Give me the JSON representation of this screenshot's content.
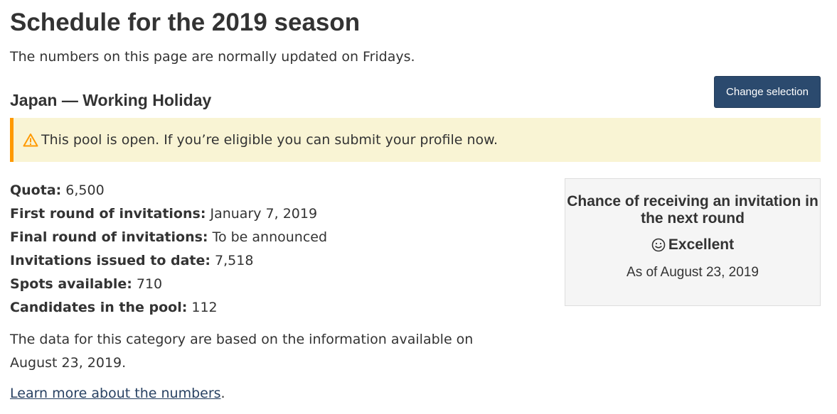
{
  "page": {
    "title": "Schedule for the 2019 season",
    "subtitle": "The numbers on this page are normally updated on Fridays."
  },
  "selection": {
    "heading": "Japan — Working Holiday",
    "change_button_label": "Change selection"
  },
  "alert": {
    "icon": "warning-triangle-icon",
    "message": "This pool is open. If you’re eligible you can submit your profile now.",
    "accent_color": "#ff9900",
    "background_color": "#f9f4d4"
  },
  "details": [
    {
      "label": "Quota:",
      "value": "6,500"
    },
    {
      "label": "First round of invitations:",
      "value": "January 7, 2019"
    },
    {
      "label": "Final round of invitations:",
      "value": "To be announced"
    },
    {
      "label": "Invitations issued to date:",
      "value": "7,518"
    },
    {
      "label": "Spots available:",
      "value": "710"
    },
    {
      "label": "Candidates in the pool:",
      "value": "112"
    }
  ],
  "data_note": "The data for this category are based on the information available on August 23, 2019.",
  "learn_more": {
    "link_text": "Learn more about the numbers",
    "suffix": "."
  },
  "chance": {
    "heading": "Chance of receiving an invitation in the next round",
    "icon": "smiley-face-icon",
    "rating": "Excellent",
    "as_of": "As of August 23, 2019"
  },
  "colors": {
    "button_background": "#2b4a6e",
    "link": "#284162",
    "text": "#333333"
  }
}
